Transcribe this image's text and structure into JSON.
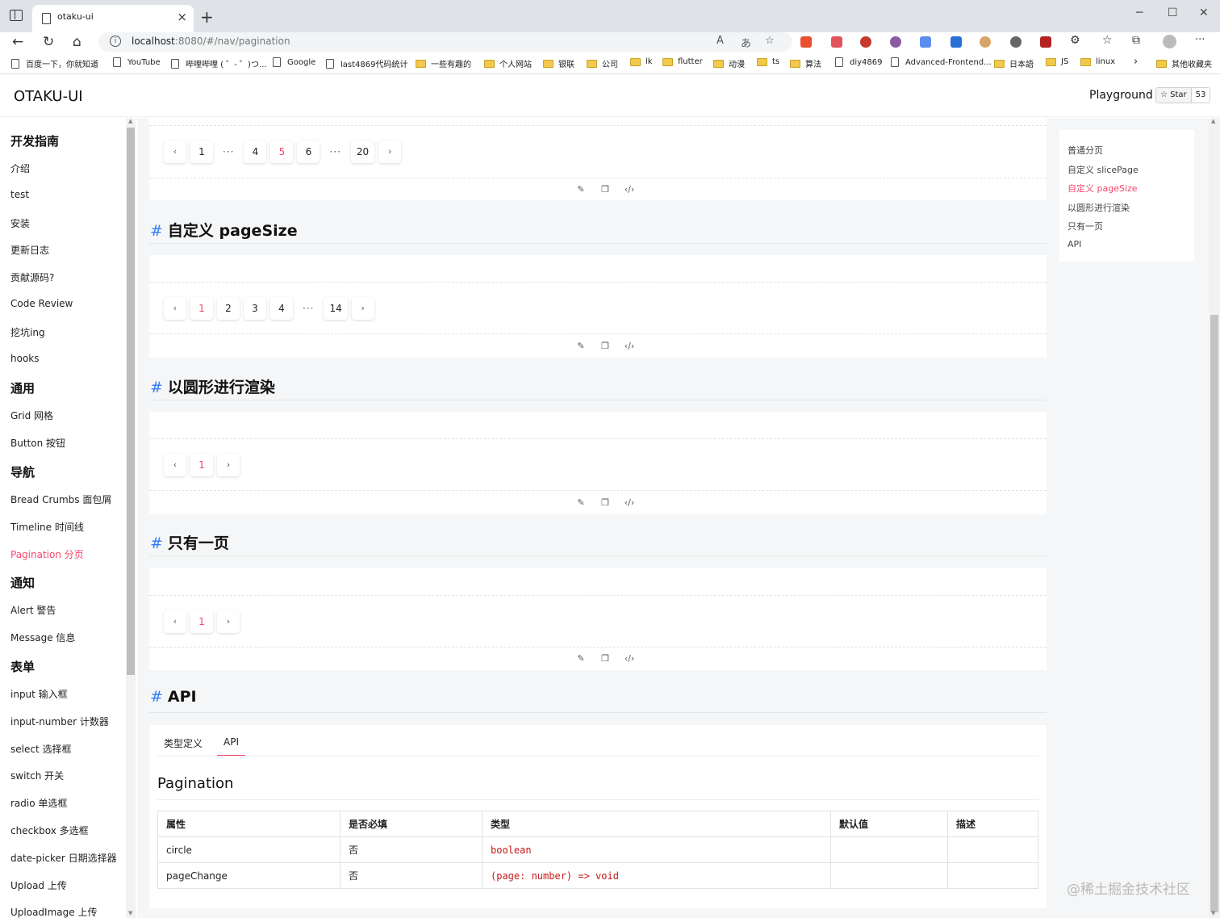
{
  "browser": {
    "tab_title": "otaku-ui",
    "tab_close": "×",
    "new_tab": "+",
    "url_host": "localhost",
    "url_rest": ":8080/#/nav/pagination",
    "window_minimize": "─",
    "window_maximize": "☐",
    "window_close": "✕"
  },
  "bookmarks": [
    {
      "label": "百度一下，你就知道",
      "type": "page"
    },
    {
      "label": "YouTube",
      "type": "page"
    },
    {
      "label": "哔哩哔哩 ( ゜- ゜)つ...",
      "type": "page"
    },
    {
      "label": "Google",
      "type": "page"
    },
    {
      "label": "last4869代码统计",
      "type": "page"
    },
    {
      "label": "一些有趣的",
      "type": "folder"
    },
    {
      "label": "个人网站",
      "type": "folder"
    },
    {
      "label": "银联",
      "type": "folder"
    },
    {
      "label": "公司",
      "type": "folder"
    },
    {
      "label": "lk",
      "type": "folder"
    },
    {
      "label": "flutter",
      "type": "folder"
    },
    {
      "label": "动漫",
      "type": "folder"
    },
    {
      "label": "ts",
      "type": "folder"
    },
    {
      "label": "算法",
      "type": "folder"
    },
    {
      "label": "diy4869",
      "type": "page"
    },
    {
      "label": "Advanced-Frontend...",
      "type": "page"
    },
    {
      "label": "日本語",
      "type": "folder"
    },
    {
      "label": "JS",
      "type": "folder"
    },
    {
      "label": "linux",
      "type": "folder"
    }
  ],
  "bookmarks_more": "›",
  "bookmarks_other": "其他收藏夹",
  "header": {
    "logo": "OTAKU-UI",
    "playground": "Playground",
    "star_label": "Star",
    "star_count": "53"
  },
  "sidebar": [
    {
      "kind": "head",
      "label": "开发指南"
    },
    {
      "kind": "item",
      "label": "介绍"
    },
    {
      "kind": "item",
      "label": "test"
    },
    {
      "kind": "item",
      "label": "安装"
    },
    {
      "kind": "item",
      "label": "更新日志"
    },
    {
      "kind": "item",
      "label": "贡献源码?"
    },
    {
      "kind": "item",
      "label": "Code Review"
    },
    {
      "kind": "item",
      "label": "挖坑ing"
    },
    {
      "kind": "item",
      "label": "hooks"
    },
    {
      "kind": "head",
      "label": "通用"
    },
    {
      "kind": "item",
      "label": "Grid 网格"
    },
    {
      "kind": "item",
      "label": "Button 按钮"
    },
    {
      "kind": "head",
      "label": "导航"
    },
    {
      "kind": "item",
      "label": "Bread Crumbs 面包屑"
    },
    {
      "kind": "item",
      "label": "Timeline 时间线"
    },
    {
      "kind": "item",
      "label": "Pagination 分页",
      "active": true
    },
    {
      "kind": "head",
      "label": "通知"
    },
    {
      "kind": "item",
      "label": "Alert 警告"
    },
    {
      "kind": "item",
      "label": "Message 信息"
    },
    {
      "kind": "head",
      "label": "表单"
    },
    {
      "kind": "item",
      "label": "input 输入框"
    },
    {
      "kind": "item",
      "label": "input-number 计数器"
    },
    {
      "kind": "item",
      "label": "select 选择框"
    },
    {
      "kind": "item",
      "label": "switch 开关"
    },
    {
      "kind": "item",
      "label": "radio 单选框"
    },
    {
      "kind": "item",
      "label": "checkbox 多选框"
    },
    {
      "kind": "item",
      "label": "date-picker 日期选择器"
    },
    {
      "kind": "item",
      "label": "Upload 上传"
    },
    {
      "kind": "item",
      "label": "UploadImage 上传"
    }
  ],
  "sections": {
    "s1": {
      "title": "自定义 pageSize"
    },
    "s2": {
      "title": "以圆形进行渲染"
    },
    "s3": {
      "title": "只有一页"
    },
    "s4": {
      "title": "API"
    }
  },
  "hash": "#",
  "pagers": {
    "p0": [
      "‹",
      "1",
      "···",
      "4",
      "5",
      "6",
      "···",
      "20",
      "›"
    ],
    "p0_active": "5",
    "p1": [
      "‹",
      "1",
      "2",
      "3",
      "4",
      "···",
      "14",
      "›"
    ],
    "p1_active": "1",
    "p2": [
      "‹",
      "1",
      "›"
    ],
    "p2_active": "1",
    "p3": [
      "‹",
      "1",
      "›"
    ],
    "p3_active": "1"
  },
  "tools": {
    "edit": "✎",
    "copy": "❐",
    "code": "‹/›"
  },
  "api": {
    "tabs": [
      "类型定义",
      "API"
    ],
    "active_tab": "API",
    "heading": "Pagination",
    "columns": [
      "属性",
      "是否必填",
      "类型",
      "默认值",
      "描述"
    ],
    "rows": [
      [
        "circle",
        "否",
        "boolean",
        "",
        ""
      ],
      [
        "pageChange",
        "否",
        "(page: number) => void",
        "",
        ""
      ]
    ]
  },
  "toc": [
    {
      "label": "普通分页"
    },
    {
      "label": "自定义 slicePage"
    },
    {
      "label": "自定义 pageSize",
      "active": true
    },
    {
      "label": "以圆形进行渲染"
    },
    {
      "label": "只有一页"
    },
    {
      "label": "API"
    }
  ],
  "watermark": "@稀土掘金技术社区",
  "colors": {
    "accent": "#f5476d",
    "hash": "#2f7df6"
  }
}
